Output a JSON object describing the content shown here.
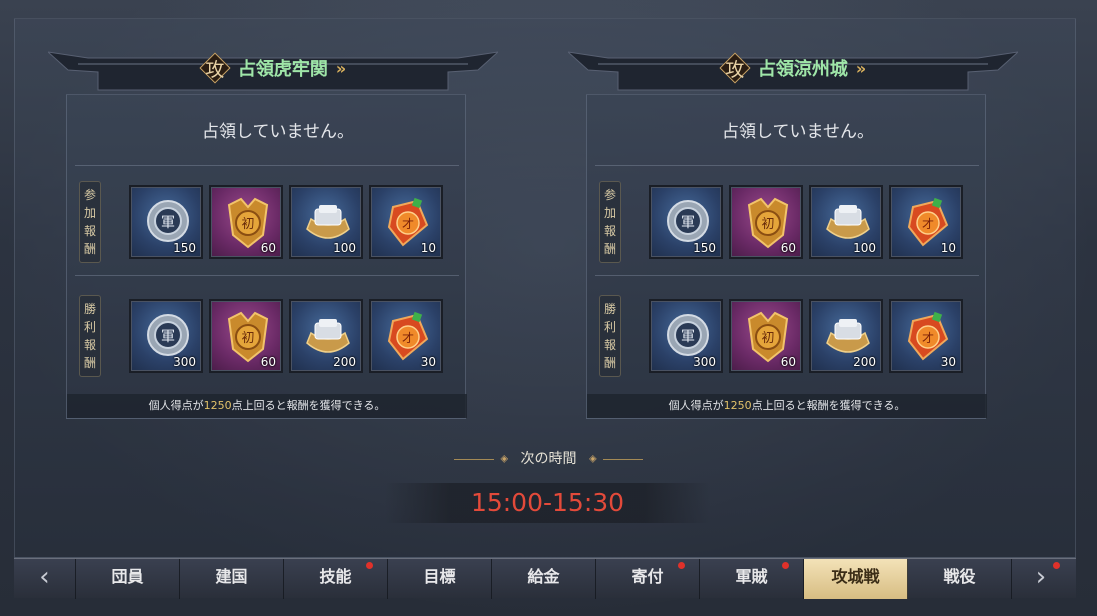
{
  "panels": [
    {
      "attack_char": "攻",
      "title": "占領虎牢関",
      "status": "占領していません。",
      "rows": [
        {
          "label": [
            "参",
            "加",
            "報",
            "酬"
          ],
          "items": [
            {
              "type": "army-token-icon",
              "qty": "150"
            },
            {
              "type": "gold-medal-icon",
              "qty": "60"
            },
            {
              "type": "silver-ingot-icon",
              "qty": "100"
            },
            {
              "type": "red-tag-icon",
              "qty": "10"
            }
          ]
        },
        {
          "label": [
            "勝",
            "利",
            "報",
            "酬"
          ],
          "items": [
            {
              "type": "army-token-icon",
              "qty": "300"
            },
            {
              "type": "gold-medal-icon",
              "qty": "60"
            },
            {
              "type": "silver-ingot-icon",
              "qty": "200"
            },
            {
              "type": "red-tag-icon",
              "qty": "30"
            }
          ]
        }
      ],
      "note_prefix": "個人得点が",
      "note_value": "1250",
      "note_suffix": "点上回ると報酬を獲得できる。"
    },
    {
      "attack_char": "攻",
      "title": "占領涼州城",
      "status": "占領していません。",
      "rows": [
        {
          "label": [
            "参",
            "加",
            "報",
            "酬"
          ],
          "items": [
            {
              "type": "army-token-icon",
              "qty": "150"
            },
            {
              "type": "gold-medal-icon",
              "qty": "60"
            },
            {
              "type": "silver-ingot-icon",
              "qty": "100"
            },
            {
              "type": "red-tag-icon",
              "qty": "10"
            }
          ]
        },
        {
          "label": [
            "勝",
            "利",
            "報",
            "酬"
          ],
          "items": [
            {
              "type": "army-token-icon",
              "qty": "300"
            },
            {
              "type": "gold-medal-icon",
              "qty": "60"
            },
            {
              "type": "silver-ingot-icon",
              "qty": "200"
            },
            {
              "type": "red-tag-icon",
              "qty": "30"
            }
          ]
        }
      ],
      "note_prefix": "個人得点が",
      "note_value": "1250",
      "note_suffix": "点上回ると報酬を獲得できる。"
    }
  ],
  "next_label": "次の時間",
  "time_range": "15:00-15:30",
  "tabs": [
    {
      "label": "団員",
      "dot": false
    },
    {
      "label": "建国",
      "dot": false
    },
    {
      "label": "技能",
      "dot": true
    },
    {
      "label": "目標",
      "dot": false
    },
    {
      "label": "給金",
      "dot": false
    },
    {
      "label": "寄付",
      "dot": true
    },
    {
      "label": "軍賊",
      "dot": true
    },
    {
      "label": "攻城戦",
      "dot": false,
      "active": true
    },
    {
      "label": "戦役",
      "dot": false
    }
  ],
  "tab_prev_icon": "chevron-left-icon",
  "tab_next_icon": "chevron-right-icon",
  "tab_next_dot": true
}
